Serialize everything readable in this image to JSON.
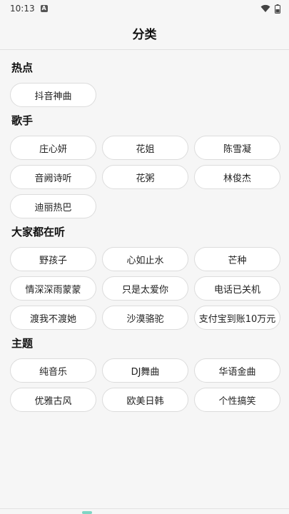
{
  "status": {
    "time": "10:13",
    "badge": "A"
  },
  "header": {
    "title": "分类"
  },
  "sections": [
    {
      "title": "热点",
      "items": [
        "抖音神曲"
      ]
    },
    {
      "title": "歌手",
      "items": [
        "庄心妍",
        "花姐",
        "陈雪凝",
        "音阙诗听",
        "花粥",
        "林俊杰",
        "迪丽热巴"
      ]
    },
    {
      "title": "大家都在听",
      "items": [
        "野孩子",
        "心如止水",
        "芒种",
        "情深深雨蒙蒙",
        "只是太爱你",
        "电话已关机",
        "渡我不渡她",
        "沙漠骆驼",
        "支付宝到账10万元"
      ]
    },
    {
      "title": "主题",
      "items": [
        "纯音乐",
        "DJ舞曲",
        "华语金曲",
        "优雅古风",
        "欧美日韩",
        "个性搞笑"
      ]
    }
  ]
}
